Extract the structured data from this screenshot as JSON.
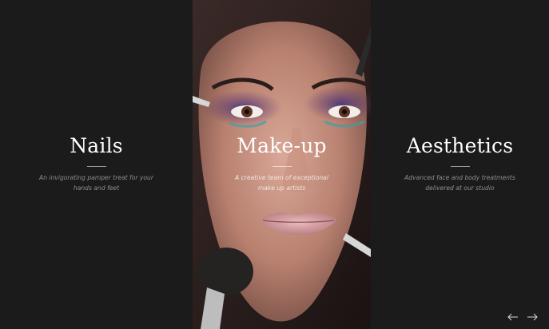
{
  "slides": [
    {
      "title": "Nails",
      "description": "An invigorating pamper treat for your hands and feet"
    },
    {
      "title": "Make-up",
      "description": "A creative team of exceptional make up artists"
    },
    {
      "title": "Aesthetics",
      "description": "Advanced face and body treatments delivered at our studio"
    }
  ],
  "nav": {
    "prev_icon": "arrow-left-icon",
    "next_icon": "arrow-right-icon"
  },
  "colors": {
    "background": "#1b1b1b",
    "title": "#ffffff",
    "description": "#8f8f8f"
  }
}
